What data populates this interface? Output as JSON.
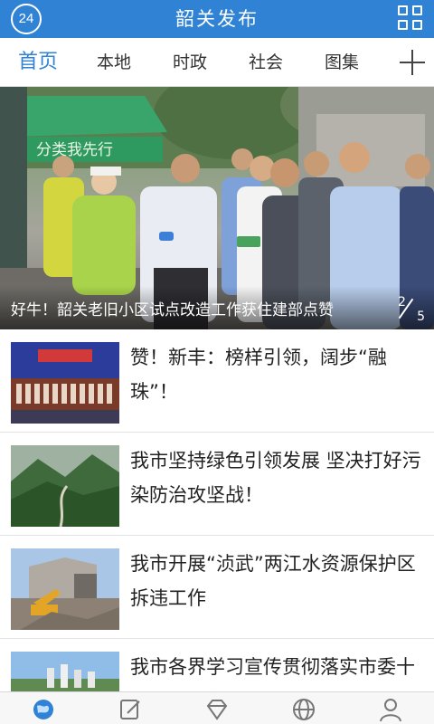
{
  "header": {
    "logo_text": "24",
    "title": "韶关发布",
    "grid_icon": "grid-icon",
    "theme_color": "#2f82d4"
  },
  "tabs": [
    {
      "label": "首页",
      "active": true
    },
    {
      "label": "本地",
      "active": false
    },
    {
      "label": "时政",
      "active": false
    },
    {
      "label": "社会",
      "active": false
    },
    {
      "label": "图集",
      "active": false
    }
  ],
  "add_tab_icon": "plus-icon",
  "banner": {
    "caption": "好牛！韶关老旧小区试点改造工作获住建部点赞",
    "sign_text": "分类我先行",
    "current_page": "2",
    "total_pages": "5"
  },
  "news": [
    {
      "title": "赞！新丰：榜样引领，阔步“融珠”！"
    },
    {
      "title": "我市坚持绿色引领发展 坚决打好污染防治攻坚战！"
    },
    {
      "title": "我市开展“浈武”两江水资源保护区拆违工作"
    },
    {
      "title": "我市各界学习宣传贯彻落实市委十二届七次全会精神"
    }
  ],
  "bottom_nav": [
    {
      "icon": "globe-pin-icon",
      "active": true
    },
    {
      "icon": "edit-icon",
      "active": false
    },
    {
      "icon": "diamond-icon",
      "active": false
    },
    {
      "icon": "globe-icon",
      "active": false
    },
    {
      "icon": "user-icon",
      "active": false
    }
  ]
}
